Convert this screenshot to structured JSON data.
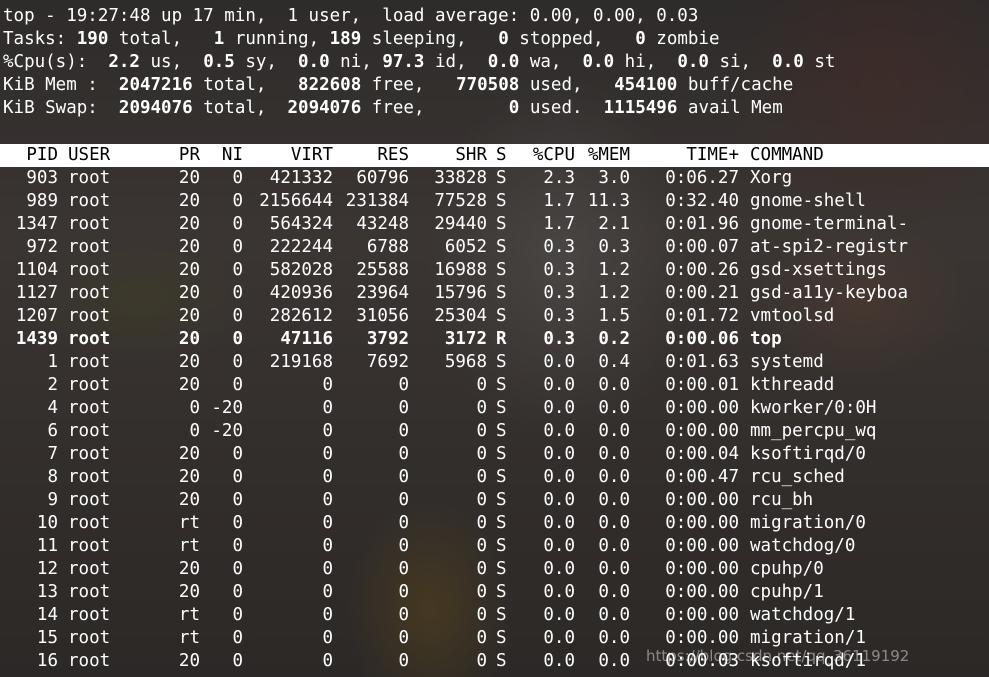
{
  "summary": {
    "line1": "top - 19:27:48 up 17 min,  1 user,  load average: 0.00, 0.00, 0.03",
    "tasks": {
      "prefix": "Tasks: ",
      "total": "190",
      "total_label": " total,   ",
      "running": "1",
      "running_label": " running, ",
      "sleeping": "189",
      "sleeping_label": " sleeping,   ",
      "stopped": "0",
      "stopped_label": " stopped,   ",
      "zombie": "0",
      "zombie_label": " zombie"
    },
    "cpu": {
      "prefix": "%Cpu(s):  ",
      "us": "2.2",
      "us_label": " us,  ",
      "sy": "0.5",
      "sy_label": " sy,  ",
      "ni": "0.0",
      "ni_label": " ni, ",
      "id": "97.3",
      "id_label": " id,  ",
      "wa": "0.0",
      "wa_label": " wa,  ",
      "hi": "0.0",
      "hi_label": " hi,  ",
      "si": "0.0",
      "si_label": " si,  ",
      "st": "0.0",
      "st_label": " st"
    },
    "mem": {
      "prefix": "KiB Mem :  ",
      "total": "2047216",
      "total_label": " total,   ",
      "free": "822608",
      "free_label": " free,   ",
      "used": "770508",
      "used_label": " used,   ",
      "buff": "454100",
      "buff_label": " buff/cache"
    },
    "swap": {
      "prefix": "KiB Swap:  ",
      "total": "2094076",
      "total_label": " total,  ",
      "free": "2094076",
      "free_label": " free,        ",
      "used": "0",
      "used_label": " used.  ",
      "avail": "1115496",
      "avail_label": " avail Mem"
    }
  },
  "columns": [
    "PID",
    "USER",
    "PR",
    "NI",
    "VIRT",
    "RES",
    "SHR",
    "S",
    "%CPU",
    "%MEM",
    "TIME+",
    "COMMAND"
  ],
  "processes": [
    {
      "pid": "903",
      "user": "root",
      "pr": "20",
      "ni": "0",
      "virt": "421332",
      "res": "60796",
      "shr": "33828",
      "s": "S",
      "cpu": "2.3",
      "mem": "3.0",
      "time": "0:06.27",
      "cmd": "Xorg",
      "bold": false
    },
    {
      "pid": "989",
      "user": "root",
      "pr": "20",
      "ni": "0",
      "virt": "2156644",
      "res": "231384",
      "shr": "77528",
      "s": "S",
      "cpu": "1.7",
      "mem": "11.3",
      "time": "0:32.40",
      "cmd": "gnome-shell",
      "bold": false
    },
    {
      "pid": "1347",
      "user": "root",
      "pr": "20",
      "ni": "0",
      "virt": "564324",
      "res": "43248",
      "shr": "29440",
      "s": "S",
      "cpu": "1.7",
      "mem": "2.1",
      "time": "0:01.96",
      "cmd": "gnome-terminal-",
      "bold": false
    },
    {
      "pid": "972",
      "user": "root",
      "pr": "20",
      "ni": "0",
      "virt": "222244",
      "res": "6788",
      "shr": "6052",
      "s": "S",
      "cpu": "0.3",
      "mem": "0.3",
      "time": "0:00.07",
      "cmd": "at-spi2-registr",
      "bold": false
    },
    {
      "pid": "1104",
      "user": "root",
      "pr": "20",
      "ni": "0",
      "virt": "582028",
      "res": "25588",
      "shr": "16988",
      "s": "S",
      "cpu": "0.3",
      "mem": "1.2",
      "time": "0:00.26",
      "cmd": "gsd-xsettings",
      "bold": false
    },
    {
      "pid": "1127",
      "user": "root",
      "pr": "20",
      "ni": "0",
      "virt": "420936",
      "res": "23964",
      "shr": "15796",
      "s": "S",
      "cpu": "0.3",
      "mem": "1.2",
      "time": "0:00.21",
      "cmd": "gsd-a11y-keyboa",
      "bold": false
    },
    {
      "pid": "1207",
      "user": "root",
      "pr": "20",
      "ni": "0",
      "virt": "282612",
      "res": "31056",
      "shr": "25304",
      "s": "S",
      "cpu": "0.3",
      "mem": "1.5",
      "time": "0:01.72",
      "cmd": "vmtoolsd",
      "bold": false
    },
    {
      "pid": "1439",
      "user": "root",
      "pr": "20",
      "ni": "0",
      "virt": "47116",
      "res": "3792",
      "shr": "3172",
      "s": "R",
      "cpu": "0.3",
      "mem": "0.2",
      "time": "0:00.06",
      "cmd": "top",
      "bold": true
    },
    {
      "pid": "1",
      "user": "root",
      "pr": "20",
      "ni": "0",
      "virt": "219168",
      "res": "7692",
      "shr": "5968",
      "s": "S",
      "cpu": "0.0",
      "mem": "0.4",
      "time": "0:01.63",
      "cmd": "systemd",
      "bold": false
    },
    {
      "pid": "2",
      "user": "root",
      "pr": "20",
      "ni": "0",
      "virt": "0",
      "res": "0",
      "shr": "0",
      "s": "S",
      "cpu": "0.0",
      "mem": "0.0",
      "time": "0:00.01",
      "cmd": "kthreadd",
      "bold": false
    },
    {
      "pid": "4",
      "user": "root",
      "pr": "0",
      "ni": "-20",
      "virt": "0",
      "res": "0",
      "shr": "0",
      "s": "S",
      "cpu": "0.0",
      "mem": "0.0",
      "time": "0:00.00",
      "cmd": "kworker/0:0H",
      "bold": false
    },
    {
      "pid": "6",
      "user": "root",
      "pr": "0",
      "ni": "-20",
      "virt": "0",
      "res": "0",
      "shr": "0",
      "s": "S",
      "cpu": "0.0",
      "mem": "0.0",
      "time": "0:00.00",
      "cmd": "mm_percpu_wq",
      "bold": false
    },
    {
      "pid": "7",
      "user": "root",
      "pr": "20",
      "ni": "0",
      "virt": "0",
      "res": "0",
      "shr": "0",
      "s": "S",
      "cpu": "0.0",
      "mem": "0.0",
      "time": "0:00.04",
      "cmd": "ksoftirqd/0",
      "bold": false
    },
    {
      "pid": "8",
      "user": "root",
      "pr": "20",
      "ni": "0",
      "virt": "0",
      "res": "0",
      "shr": "0",
      "s": "S",
      "cpu": "0.0",
      "mem": "0.0",
      "time": "0:00.47",
      "cmd": "rcu_sched",
      "bold": false
    },
    {
      "pid": "9",
      "user": "root",
      "pr": "20",
      "ni": "0",
      "virt": "0",
      "res": "0",
      "shr": "0",
      "s": "S",
      "cpu": "0.0",
      "mem": "0.0",
      "time": "0:00.00",
      "cmd": "rcu_bh",
      "bold": false
    },
    {
      "pid": "10",
      "user": "root",
      "pr": "rt",
      "ni": "0",
      "virt": "0",
      "res": "0",
      "shr": "0",
      "s": "S",
      "cpu": "0.0",
      "mem": "0.0",
      "time": "0:00.00",
      "cmd": "migration/0",
      "bold": false
    },
    {
      "pid": "11",
      "user": "root",
      "pr": "rt",
      "ni": "0",
      "virt": "0",
      "res": "0",
      "shr": "0",
      "s": "S",
      "cpu": "0.0",
      "mem": "0.0",
      "time": "0:00.00",
      "cmd": "watchdog/0",
      "bold": false
    },
    {
      "pid": "12",
      "user": "root",
      "pr": "20",
      "ni": "0",
      "virt": "0",
      "res": "0",
      "shr": "0",
      "s": "S",
      "cpu": "0.0",
      "mem": "0.0",
      "time": "0:00.00",
      "cmd": "cpuhp/0",
      "bold": false
    },
    {
      "pid": "13",
      "user": "root",
      "pr": "20",
      "ni": "0",
      "virt": "0",
      "res": "0",
      "shr": "0",
      "s": "S",
      "cpu": "0.0",
      "mem": "0.0",
      "time": "0:00.00",
      "cmd": "cpuhp/1",
      "bold": false
    },
    {
      "pid": "14",
      "user": "root",
      "pr": "rt",
      "ni": "0",
      "virt": "0",
      "res": "0",
      "shr": "0",
      "s": "S",
      "cpu": "0.0",
      "mem": "0.0",
      "time": "0:00.00",
      "cmd": "watchdog/1",
      "bold": false
    },
    {
      "pid": "15",
      "user": "root",
      "pr": "rt",
      "ni": "0",
      "virt": "0",
      "res": "0",
      "shr": "0",
      "s": "S",
      "cpu": "0.0",
      "mem": "0.0",
      "time": "0:00.00",
      "cmd": "migration/1",
      "bold": false
    },
    {
      "pid": "16",
      "user": "root",
      "pr": "20",
      "ni": "0",
      "virt": "0",
      "res": "0",
      "shr": "0",
      "s": "S",
      "cpu": "0.0",
      "mem": "0.0",
      "time": "0:00.03",
      "cmd": "ksoftirqd/1",
      "bold": false
    }
  ],
  "watermark": "https://blog.csdn.net/qq_36119192",
  "colors": {
    "text": "#ffffff",
    "header_bar": "#ffffff",
    "header_text": "#000000"
  }
}
